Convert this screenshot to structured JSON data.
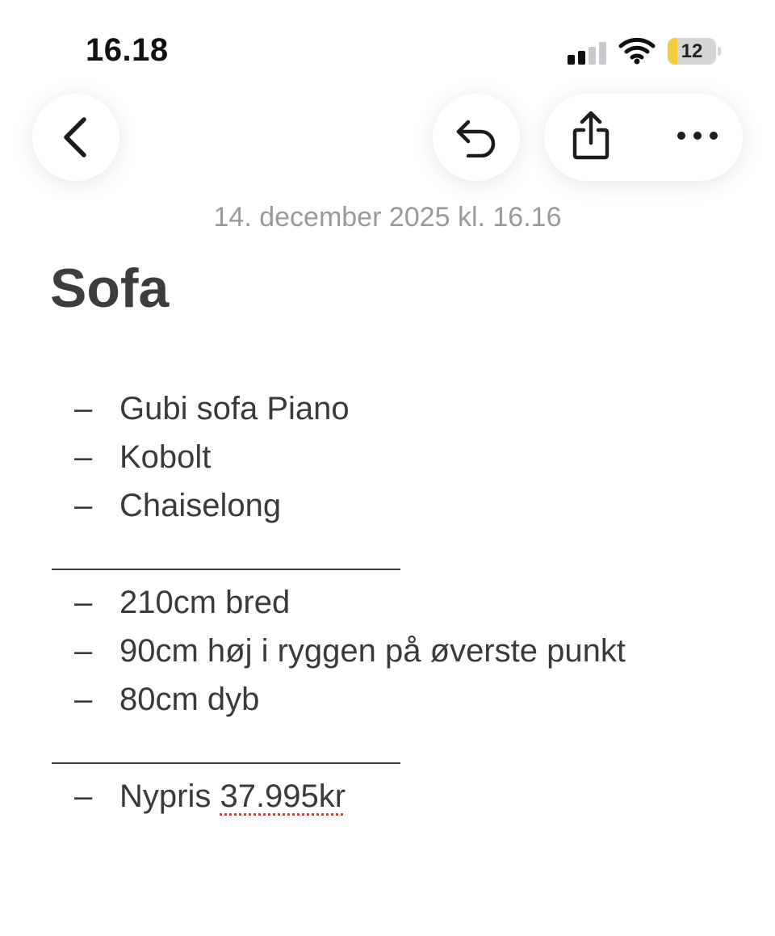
{
  "status_bar": {
    "time": "16.18",
    "battery_level": "12",
    "battery_fraction": 0.2,
    "signal_bars_active": 2,
    "signal_bars_total": 4,
    "colors": {
      "battery_fill": "#f4cd3a",
      "battery_track": "#d6d6d8"
    }
  },
  "toolbar": {
    "back_icon": "chevron-left-icon",
    "undo_icon": "undo-arrow-icon",
    "share_icon": "share-icon",
    "more_icon": "ellipsis-icon"
  },
  "note": {
    "date": "14. december 2025 kl. 16.16",
    "title": "Sofa",
    "dash": "–",
    "group1": [
      "Gubi sofa Piano",
      "Kobolt",
      "Chaiselong"
    ],
    "group2": [
      "210cm bred",
      "90cm høj i ryggen på øverste punkt",
      "80cm dyb"
    ],
    "price_prefix": "Nypris ",
    "price_value": "37.995kr"
  },
  "colors": {
    "text": "#3a3a3c",
    "date": "#9a9a9e",
    "spellcheck": "#e03a3a"
  }
}
